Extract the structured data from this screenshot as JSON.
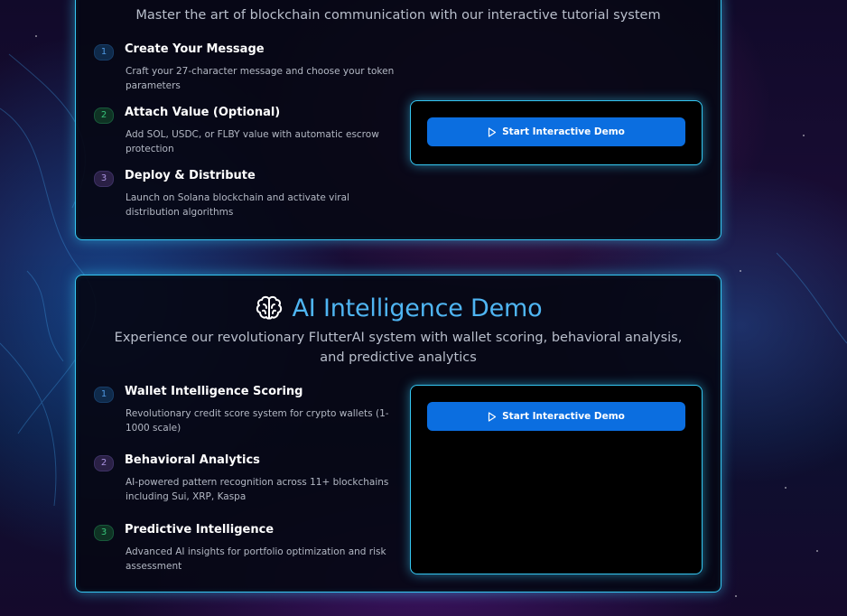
{
  "top_card": {
    "subtitle": "Master the art of blockchain communication with our interactive tutorial system",
    "steps": [
      {
        "num": "1",
        "title": "Create Your Message",
        "desc": "Craft your 27-character message and choose your token parameters"
      },
      {
        "num": "2",
        "title": "Attach Value (Optional)",
        "desc": "Add SOL, USDC, or FLBY value with automatic escrow protection"
      },
      {
        "num": "3",
        "title": "Deploy & Distribute",
        "desc": "Launch on Solana blockchain and activate viral distribution algorithms"
      }
    ],
    "demo_button": "Start Interactive Demo"
  },
  "ai_card": {
    "title": "AI Intelligence Demo",
    "icon": "brain-icon",
    "subtitle": "Experience our revolutionary FlutterAI system with wallet scoring, behavioral analysis, and predictive analytics",
    "steps": [
      {
        "num": "1",
        "title": "Wallet Intelligence Scoring",
        "desc": "Revolutionary credit score system for crypto wallets (1-1000 scale)"
      },
      {
        "num": "2",
        "title": "Behavioral Analytics",
        "desc": "AI-powered pattern recognition across 11+ blockchains including Sui, XRP, Kaspa"
      },
      {
        "num": "3",
        "title": "Predictive Intelligence",
        "desc": "Advanced AI insights for portfolio optimization and risk assessment"
      }
    ],
    "demo_button": "Start Interactive Demo"
  },
  "colors": {
    "accent_border": "#35c7f2",
    "title_blue": "#4fb5f2",
    "button_blue": "#0b6ee0"
  }
}
